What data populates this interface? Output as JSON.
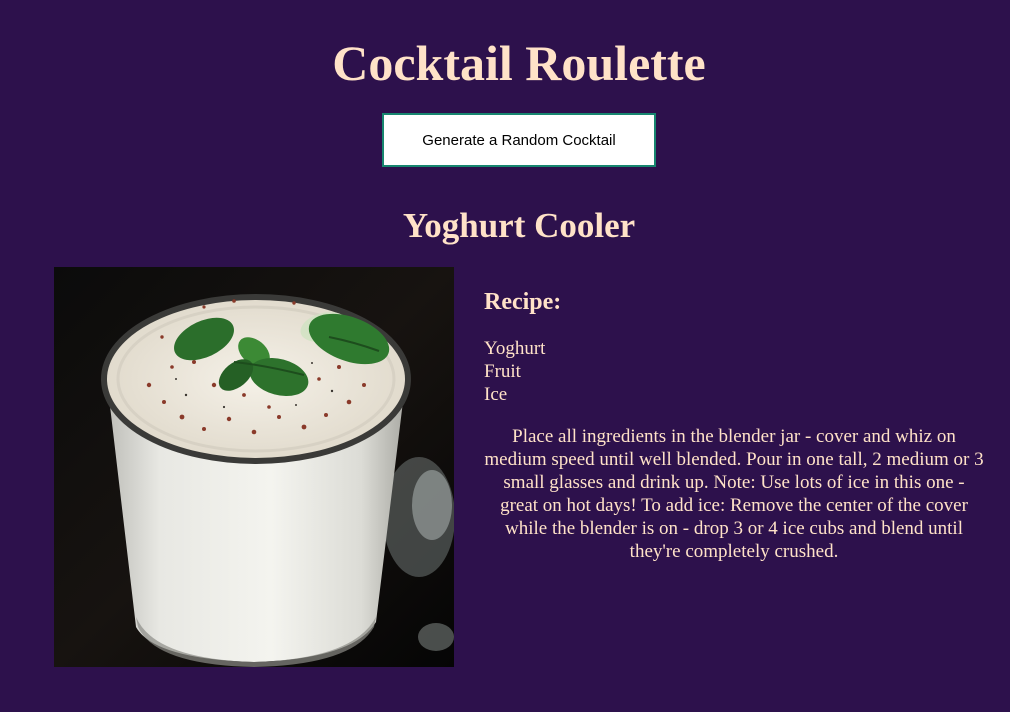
{
  "header": {
    "title": "Cocktail Roulette",
    "generate_button_label": "Generate a Random Cocktail"
  },
  "cocktail": {
    "name": "Yoghurt Cooler",
    "image_alt": "Yoghurt Cooler",
    "recipe_heading": "Recipe:",
    "ingredients": [
      "Yoghurt",
      "Fruit",
      "Ice"
    ],
    "instructions": "Place all ingredients in the blender jar - cover and whiz on medium speed until well blended. Pour in one tall, 2 medium or 3 small glasses and drink up. Note: Use lots of ice in this one - great on hot days! To add ice: Remove the center of the cover while the blender is on - drop 3 or 4 ice cubs and blend until they're completely crushed."
  },
  "colors": {
    "background": "#2d114c",
    "heading_text": "#ffe2c8",
    "button_border": "#17866f",
    "button_background": "#ffffff"
  }
}
